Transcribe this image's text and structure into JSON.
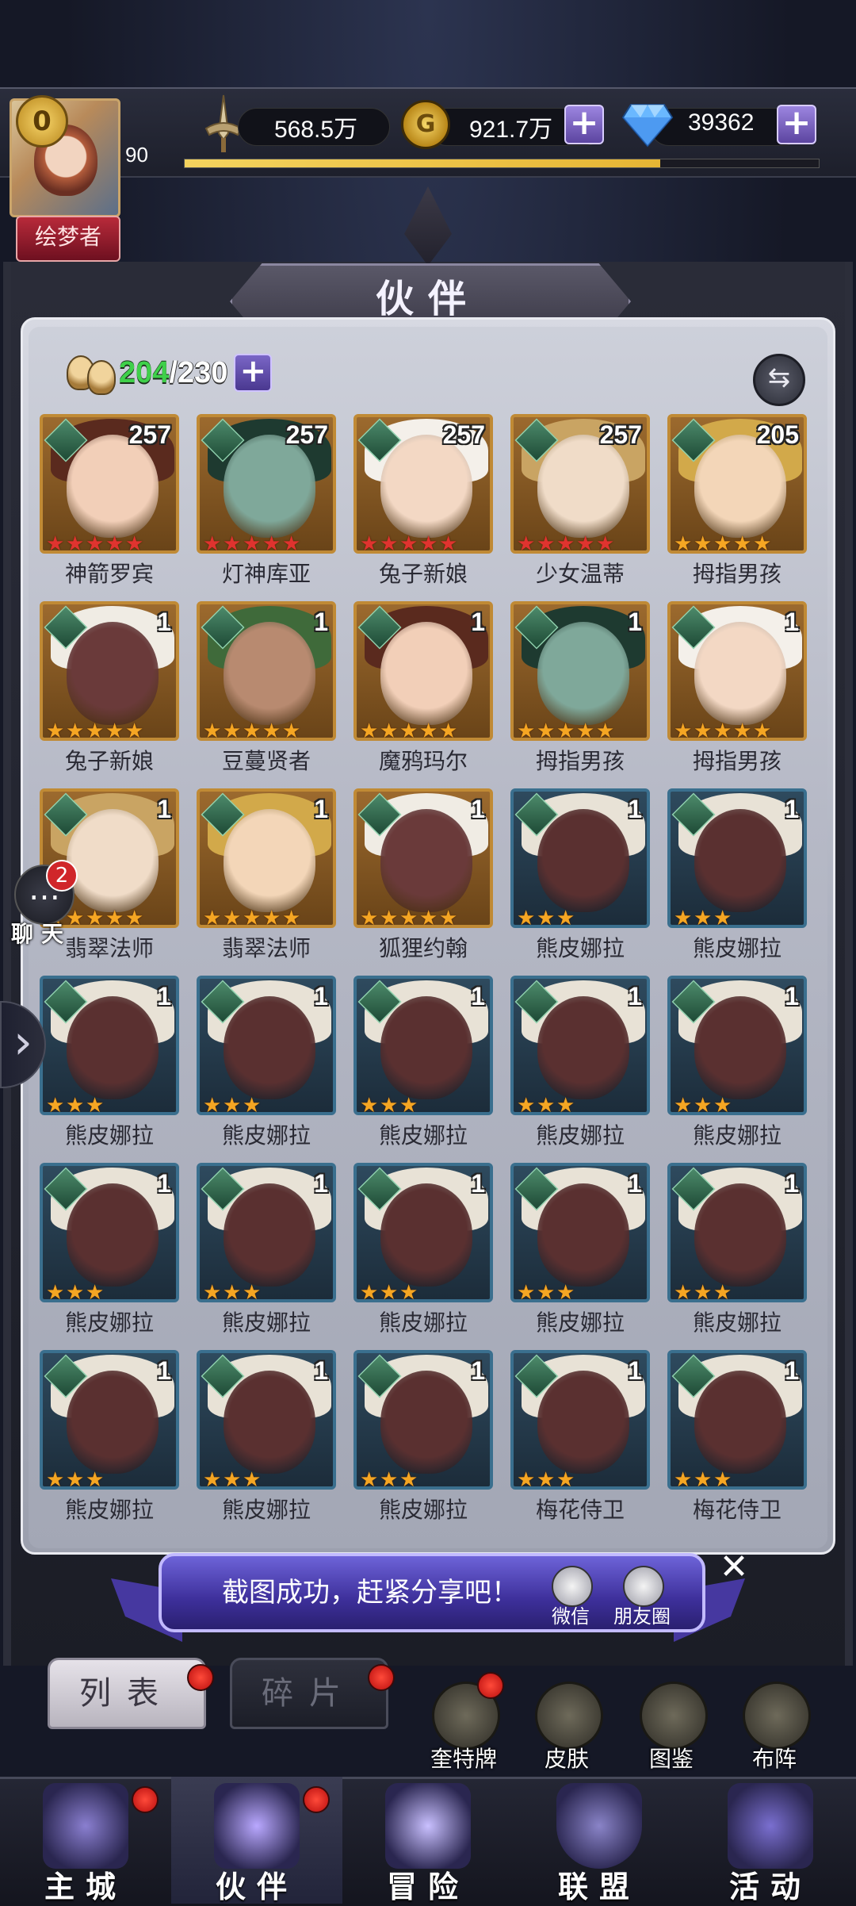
{
  "player": {
    "vip": "0",
    "level": "90",
    "title": "绘梦者",
    "xp_fraction": 0.75
  },
  "resources": {
    "power": "568.5万",
    "gold": "921.7万",
    "diamonds": "39362"
  },
  "header": {
    "title": "伙伴"
  },
  "roster": {
    "current": "204",
    "max": "/230"
  },
  "heroes": [
    {
      "name": "神箭罗宾",
      "level": "257",
      "stars": 5,
      "red": true,
      "frame": "gold"
    },
    {
      "name": "灯神库亚",
      "level": "257",
      "stars": 5,
      "red": true,
      "frame": "gold"
    },
    {
      "name": "兔子新娘",
      "level": "257",
      "stars": 5,
      "red": true,
      "frame": "gold"
    },
    {
      "name": "少女温蒂",
      "level": "257",
      "stars": 5,
      "red": true,
      "frame": "gold"
    },
    {
      "name": "拇指男孩",
      "level": "205",
      "stars": 5,
      "red": false,
      "frame": "gold"
    },
    {
      "name": "兔子新娘",
      "level": "1",
      "stars": 5,
      "red": false,
      "frame": "gold"
    },
    {
      "name": "豆蔓贤者",
      "level": "1",
      "stars": 5,
      "red": false,
      "frame": "gold"
    },
    {
      "name": "魔鸦玛尔",
      "level": "1",
      "stars": 5,
      "red": false,
      "frame": "gold"
    },
    {
      "name": "拇指男孩",
      "level": "1",
      "stars": 5,
      "red": false,
      "frame": "gold"
    },
    {
      "name": "拇指男孩",
      "level": "1",
      "stars": 5,
      "red": false,
      "frame": "gold"
    },
    {
      "name": "翡翠法师",
      "level": "1",
      "stars": 5,
      "red": false,
      "frame": "gold"
    },
    {
      "name": "翡翠法师",
      "level": "1",
      "stars": 5,
      "red": false,
      "frame": "gold"
    },
    {
      "name": "狐狸约翰",
      "level": "1",
      "stars": 5,
      "red": false,
      "frame": "gold"
    },
    {
      "name": "熊皮娜拉",
      "level": "1",
      "stars": 3,
      "red": false,
      "frame": "blue"
    },
    {
      "name": "熊皮娜拉",
      "level": "1",
      "stars": 3,
      "red": false,
      "frame": "blue"
    },
    {
      "name": "熊皮娜拉",
      "level": "1",
      "stars": 3,
      "red": false,
      "frame": "blue"
    },
    {
      "name": "熊皮娜拉",
      "level": "1",
      "stars": 3,
      "red": false,
      "frame": "blue"
    },
    {
      "name": "熊皮娜拉",
      "level": "1",
      "stars": 3,
      "red": false,
      "frame": "blue"
    },
    {
      "name": "熊皮娜拉",
      "level": "1",
      "stars": 3,
      "red": false,
      "frame": "blue"
    },
    {
      "name": "熊皮娜拉",
      "level": "1",
      "stars": 3,
      "red": false,
      "frame": "blue"
    },
    {
      "name": "熊皮娜拉",
      "level": "1",
      "stars": 3,
      "red": false,
      "frame": "blue"
    },
    {
      "name": "熊皮娜拉",
      "level": "1",
      "stars": 3,
      "red": false,
      "frame": "blue"
    },
    {
      "name": "熊皮娜拉",
      "level": "1",
      "stars": 3,
      "red": false,
      "frame": "blue"
    },
    {
      "name": "熊皮娜拉",
      "level": "1",
      "stars": 3,
      "red": false,
      "frame": "blue"
    },
    {
      "name": "熊皮娜拉",
      "level": "1",
      "stars": 3,
      "red": false,
      "frame": "blue"
    },
    {
      "name": "熊皮娜拉",
      "level": "1",
      "stars": 3,
      "red": false,
      "frame": "blue"
    },
    {
      "name": "熊皮娜拉",
      "level": "1",
      "stars": 3,
      "red": false,
      "frame": "blue"
    },
    {
      "name": "熊皮娜拉",
      "level": "1",
      "stars": 3,
      "red": false,
      "frame": "blue"
    },
    {
      "name": "梅花侍卫",
      "level": "1",
      "stars": 3,
      "red": false,
      "frame": "blue"
    },
    {
      "name": "梅花侍卫",
      "level": "1",
      "stars": 3,
      "red": false,
      "frame": "blue"
    }
  ],
  "chat": {
    "label": "聊天",
    "unread": "2"
  },
  "share": {
    "message": "截图成功，赶紧分享吧！",
    "wechat": "微信",
    "moments": "朋友圈"
  },
  "subtabs": {
    "list": "列表",
    "fragments": "碎片"
  },
  "tools": [
    {
      "label": "奎特牌",
      "icon": "tarot-card-icon"
    },
    {
      "label": "皮肤",
      "icon": "outfit-icon"
    },
    {
      "label": "图鉴",
      "icon": "gallery-book-icon"
    },
    {
      "label": "布阵",
      "icon": "formation-icon"
    }
  ],
  "nav": [
    {
      "label": "主城",
      "icon": "castle-icon"
    },
    {
      "label": "伙伴",
      "icon": "wizard-hat-icon"
    },
    {
      "label": "冒险",
      "icon": "compass-icon"
    },
    {
      "label": "联盟",
      "icon": "shield-icon"
    },
    {
      "label": "活动",
      "icon": "cards-icon"
    }
  ]
}
